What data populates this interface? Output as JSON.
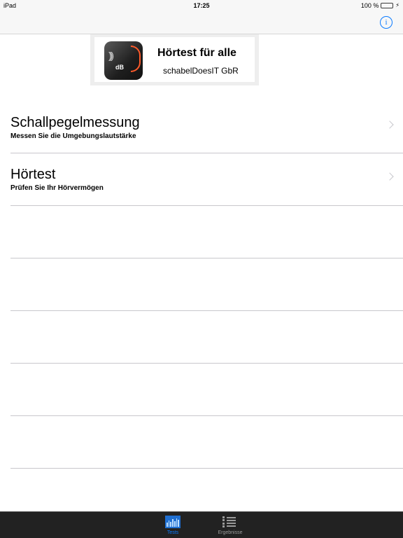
{
  "status_bar": {
    "carrier": "iPad",
    "time": "17:25",
    "battery": "100 %"
  },
  "nav_bar": {
    "info_icon": "info-circle-icon",
    "info_label": "i"
  },
  "banner": {
    "title": "Hörtest für alle",
    "subtitle": "schabelDoesIT GbR",
    "icon_label": "dB"
  },
  "list": {
    "items": [
      {
        "title": "Schallpegelmessung",
        "subtitle": "Messen Sie die Umgebungslautstärke"
      },
      {
        "title": "Hörtest",
        "subtitle": "Prüfen Sie Ihr Hörvermögen"
      }
    ]
  },
  "tab_bar": {
    "tabs": [
      {
        "label": "Tests",
        "icon": "bar-chart-icon",
        "selected": true
      },
      {
        "label": "Ergebnisse",
        "icon": "list-icon",
        "selected": false
      }
    ]
  },
  "colors": {
    "accent": "#0a7aff",
    "battery": "#4cd964",
    "tab_bar_bg": "#222222"
  }
}
